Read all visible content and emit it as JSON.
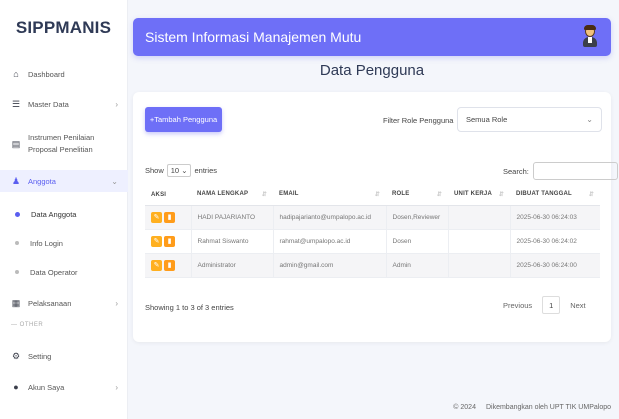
{
  "sidebar": {
    "brand": "SIPPMANIS",
    "items": [
      {
        "label": "Dashboard",
        "icon": "home-icon"
      },
      {
        "label": "Master Data",
        "icon": "database-icon"
      },
      {
        "label": "Instrumen Penilaian Proposal Penelitian",
        "icon": "document-icon"
      },
      {
        "label": "Anggota",
        "icon": "user-icon"
      },
      {
        "label": "Pelaksanaan",
        "icon": "calendar-icon"
      },
      {
        "label": "Setting",
        "icon": "gear-icon"
      },
      {
        "label": "Akun Saya",
        "icon": "account-icon"
      }
    ],
    "sub_items": [
      "Data Anggota",
      "Info Login",
      "Data Operator"
    ],
    "section_other": "OTHER"
  },
  "header": {
    "title": "Sistem Informasi Manajemen Mutu"
  },
  "page": {
    "title": "Data Pengguna"
  },
  "toolbar": {
    "add_label": "+Tambah Pengguna",
    "filter_label": "Filter Role Pengguna",
    "filter_value": "Semua Role"
  },
  "table_controls": {
    "show_label": "Show",
    "show_value": "10",
    "entries_label": "entries",
    "search_label": "Search:"
  },
  "table": {
    "columns": [
      "AKSI",
      "NAMA LENGKAP",
      "EMAIL",
      "ROLE",
      "UNIT KERJA",
      "DIBUAT TANGGAL"
    ],
    "rows": [
      {
        "name": "HADI PAJARIANTO",
        "email": "hadipajarianto@umpalopo.ac.id",
        "role": "Dosen,Reviewer",
        "unit": "",
        "created": "2025-06-30 06:24:03"
      },
      {
        "name": "Rahmat Siswanto",
        "email": "rahmat@umpalopo.ac.id",
        "role": "Dosen",
        "unit": "",
        "created": "2025-06-30 06:24:02"
      },
      {
        "name": "Administrator",
        "email": "admin@gmail.com",
        "role": "Admin",
        "unit": "",
        "created": "2025-06-30 06:24:00"
      }
    ]
  },
  "pagination": {
    "info": "Showing 1 to 3 of 3 entries",
    "previous": "Previous",
    "current": "1",
    "next": "Next"
  },
  "footer": {
    "year": "© 2024",
    "credit": "Dikembangkan oleh UPT TIK UMPalopo"
  },
  "colors": {
    "accent": "#6e6ff7",
    "action_orange": "#ffb020"
  }
}
